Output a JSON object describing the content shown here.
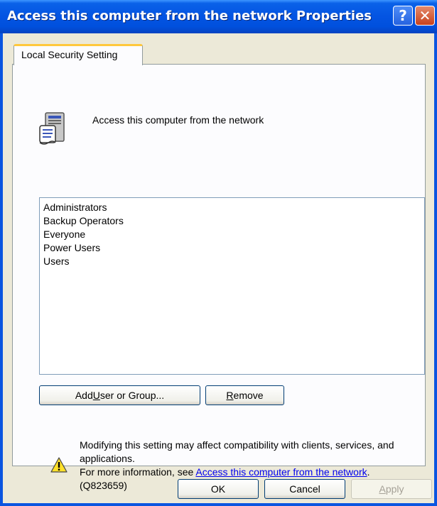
{
  "window": {
    "title": "Access this computer from the network Properties",
    "help_glyph": "?",
    "close_glyph": "✕",
    "colors": {
      "titlebar": "#0454e2",
      "client": "#ece9d8",
      "tab_accent": "#ffc83c"
    }
  },
  "tab": {
    "label": "Local Security Setting"
  },
  "policy": {
    "icon": "policy-document-icon",
    "name": "Access this computer from the network"
  },
  "members": [
    "Administrators",
    "Backup Operators",
    "Everyone",
    "Power Users",
    "Users"
  ],
  "buttons": {
    "add": {
      "pre": "Add ",
      "accel": "U",
      "post": "ser or Group..."
    },
    "remove": {
      "pre": "",
      "accel": "R",
      "post": "emove"
    },
    "ok": "OK",
    "cancel": "Cancel",
    "apply": {
      "pre": "",
      "accel": "A",
      "post": "pply"
    }
  },
  "warning": {
    "icon": "warning-icon",
    "line1": "Modifying this setting may affect compatibility with clients, services, and applications.",
    "info_prefix": "For more information, see ",
    "link_text": "Access this computer from the network",
    "info_suffix": ".",
    "kb_ref": "(Q823659)"
  }
}
